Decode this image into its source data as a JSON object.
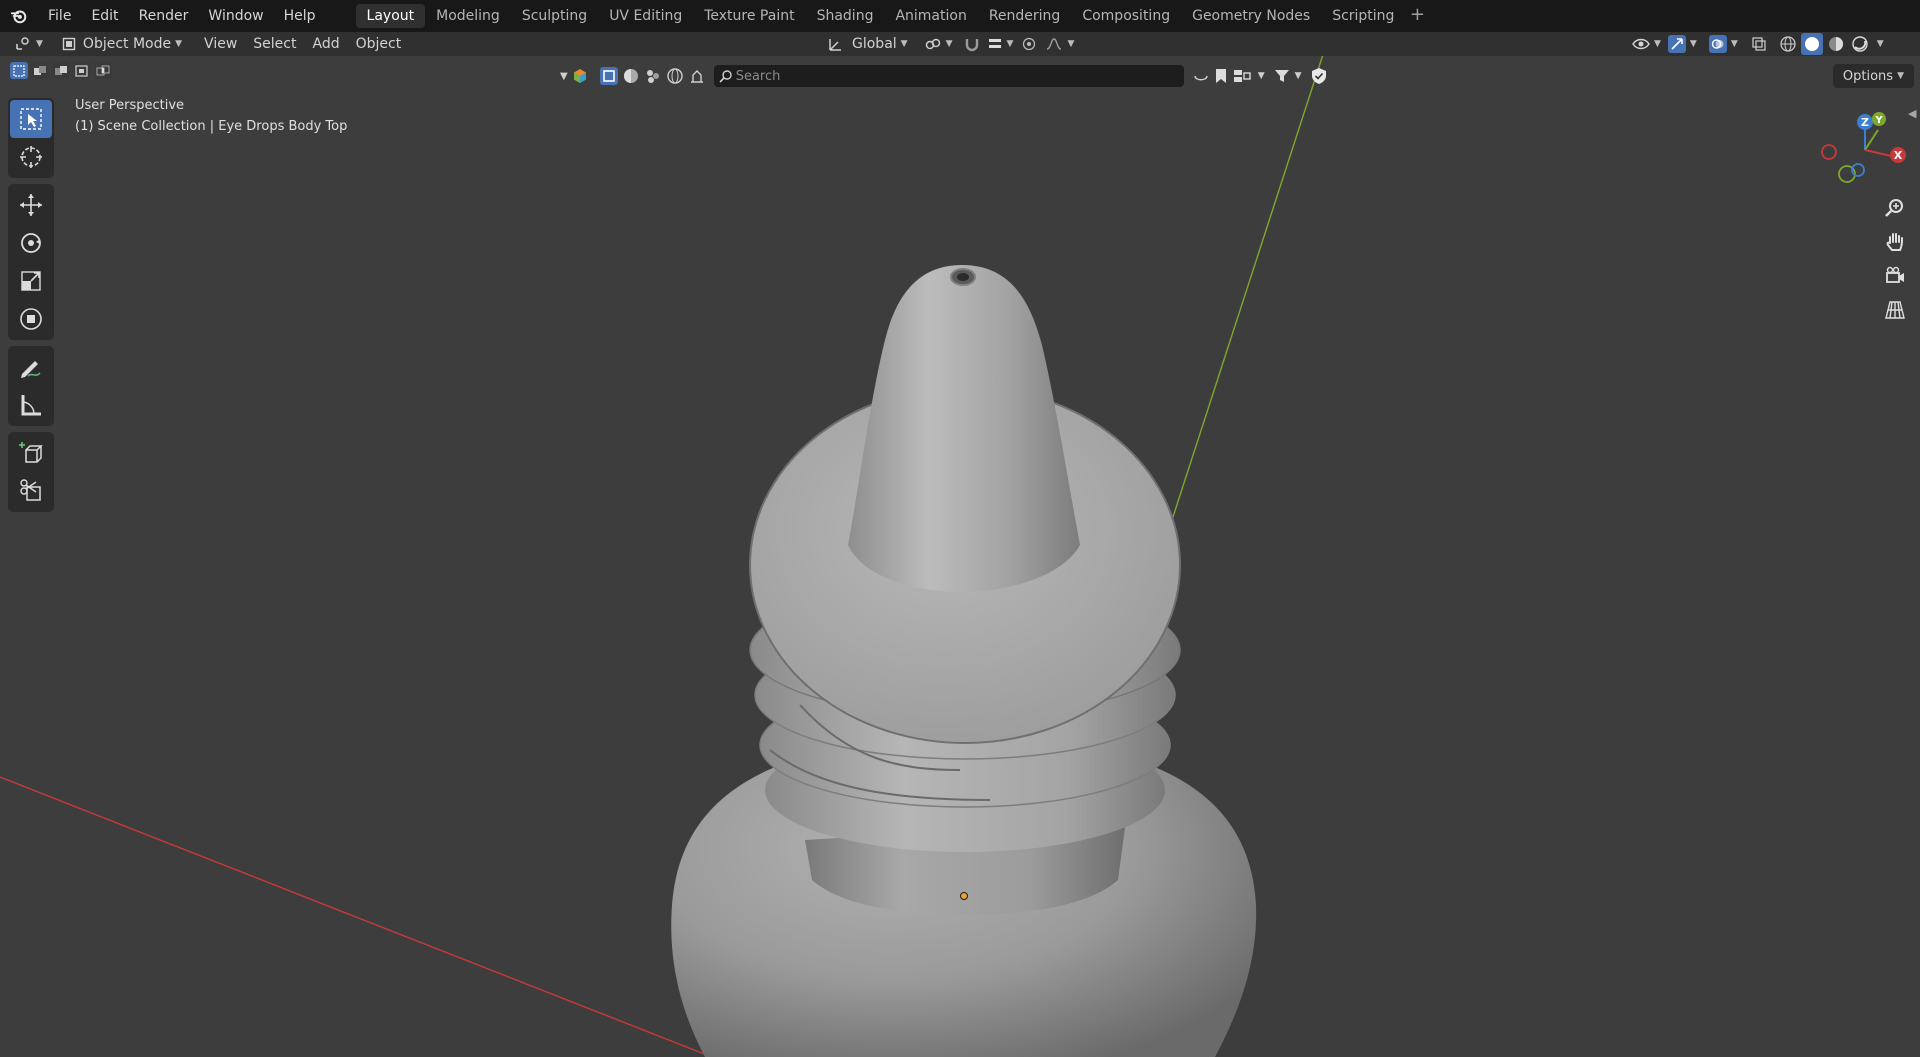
{
  "topbar": {
    "menus": [
      "File",
      "Edit",
      "Render",
      "Window",
      "Help"
    ],
    "workspaces": [
      "Layout",
      "Modeling",
      "Sculpting",
      "UV Editing",
      "Texture Paint",
      "Shading",
      "Animation",
      "Rendering",
      "Compositing",
      "Geometry Nodes",
      "Scripting"
    ],
    "active_workspace": "Layout",
    "add_label": "+"
  },
  "header": {
    "mode": "Object Mode",
    "menus": [
      "View",
      "Select",
      "Add",
      "Object"
    ],
    "orientation": "Global"
  },
  "viewport_header": {
    "search_placeholder": "Search",
    "options_label": "Options"
  },
  "overlay": {
    "perspective": "User Perspective",
    "collection": "(1) Scene Collection | Eye Drops Body Top"
  },
  "gizmo": {
    "z_label": "Z",
    "y_label": "Y",
    "x_label": "X"
  },
  "colors": {
    "accent": "#4772b3",
    "axis_x": "#c8393a",
    "axis_y": "#7ca82c",
    "axis_z": "#3a7fd0",
    "background": "#3d3d3d"
  }
}
